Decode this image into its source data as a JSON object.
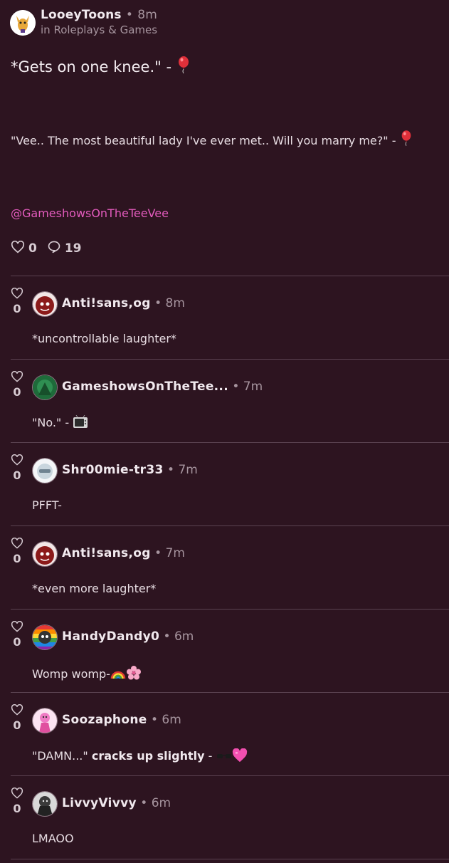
{
  "post": {
    "author": "LooeyToons",
    "time": "8m",
    "community": "in Roleplays & Games",
    "title": "*Gets on one knee.\" -",
    "body": "\"Vee.. The most beautiful lady I've ever met.. Will you marry me?\" -",
    "mention": "@GameshowsOnTheTeeVee",
    "likes": "0",
    "comments": "19"
  },
  "separator": "•",
  "comments": [
    {
      "likes": "0",
      "author": "Anti!sans,og",
      "time": "8m",
      "text": "*uncontrollable laughter*",
      "avatar_color": "#8b1a1a"
    },
    {
      "likes": "0",
      "author": "GameshowsOnTheTee...",
      "time": "7m",
      "text": "\"No.\" -",
      "avatar_color": "#1e6b3a"
    },
    {
      "likes": "0",
      "author": "Shr00mie-tr33",
      "time": "7m",
      "text": "PFFT-",
      "avatar_color": "#c9d6de"
    },
    {
      "likes": "0",
      "author": "Anti!sans,og",
      "time": "7m",
      "text": "*even more laughter*",
      "avatar_color": "#8b1a1a"
    },
    {
      "likes": "0",
      "author": "HandyDandy0",
      "time": "6m",
      "text": "Womp womp-",
      "avatar_color": "#6b4fa3"
    },
    {
      "likes": "0",
      "author": "Soozaphone",
      "time": "6m",
      "text": "\"DAMN...\"",
      "text_bold": "cracks up slightly",
      "text_tail": "-",
      "avatar_color": "#f07ac4"
    },
    {
      "likes": "0",
      "author": "LivvyVivvy",
      "time": "6m",
      "text": "LMAOO",
      "avatar_color": "#3a3a3a"
    }
  ],
  "icons": {
    "like": "heart-outline-icon",
    "comment": "speech-bubble-icon",
    "balloon": "red-balloon-emoji",
    "tv": "television-emoji",
    "rainbow": "rainbow-emoji",
    "flower": "cherry-blossom-emoji",
    "sunglasses": "sunglasses-emoji",
    "heart": "pink-heart-emoji"
  }
}
